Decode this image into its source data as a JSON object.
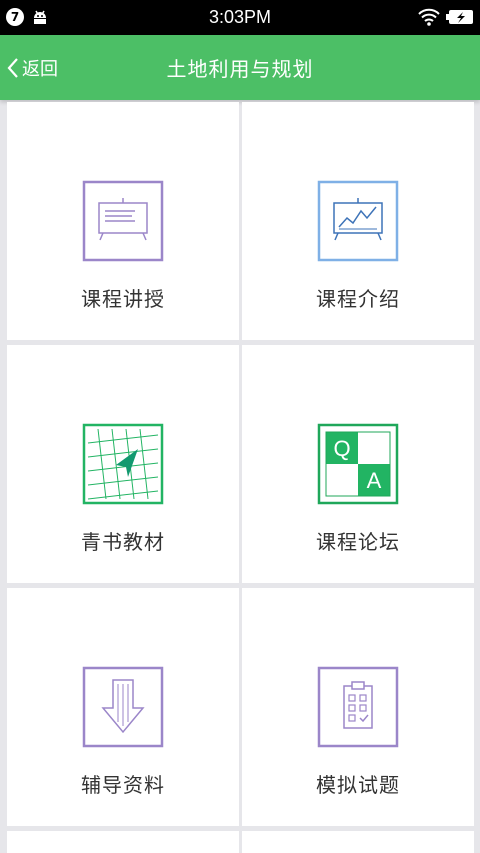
{
  "statusbar": {
    "badge": "7",
    "time": "3:03PM"
  },
  "appbar": {
    "back_label": "返回",
    "title": "土地利用与规划"
  },
  "tiles": [
    {
      "label": "课程讲授",
      "icon": "lecture-board-icon"
    },
    {
      "label": "课程介绍",
      "icon": "chart-board-icon"
    },
    {
      "label": "青书教材",
      "icon": "map-navigation-icon"
    },
    {
      "label": "课程论坛",
      "icon": "qa-icon"
    },
    {
      "label": "辅导资料",
      "icon": "download-arrow-icon"
    },
    {
      "label": "模拟试题",
      "icon": "clipboard-checklist-icon"
    }
  ],
  "colors": {
    "appbar": "#4cbf66",
    "purple": "#9b86c9",
    "blue": "#7fb0e6",
    "green": "#22b463",
    "teal": "#12996f"
  }
}
